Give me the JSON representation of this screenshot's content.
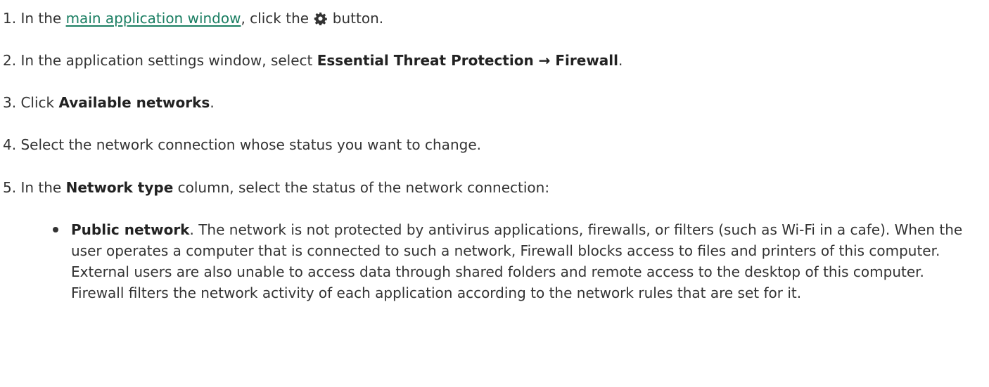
{
  "steps": [
    {
      "number": "1.",
      "prefix": "In the",
      "link": "main application window",
      "middle": ", click the",
      "icon": "gear-icon",
      "suffix": "button."
    },
    {
      "number": "2.",
      "prefix": "In the application settings window, select",
      "bold": "Essential Threat Protection → Firewall",
      "suffix": "."
    },
    {
      "number": "3.",
      "prefix": "Click",
      "bold": "Available networks",
      "suffix": "."
    },
    {
      "number": "4.",
      "text": "Select the network connection whose status you want to change."
    },
    {
      "number": "5.",
      "prefix": "In the",
      "bold": "Network type",
      "suffix": "column, select the status of the network connection:"
    }
  ],
  "bullets": [
    {
      "term": "Public network",
      "text": ". The network is not protected by antivirus applications, firewalls, or filters (such as Wi-Fi in a cafe). When the user operates a computer that is connected to such a network, Firewall blocks access to files and printers of this computer. External users are also unable to access data through shared folders and remote access to the desktop of this computer. Firewall filters the network activity of each application according to the network rules that are set for it."
    }
  ],
  "colors": {
    "link": "#1a7e62",
    "text": "#333333"
  }
}
